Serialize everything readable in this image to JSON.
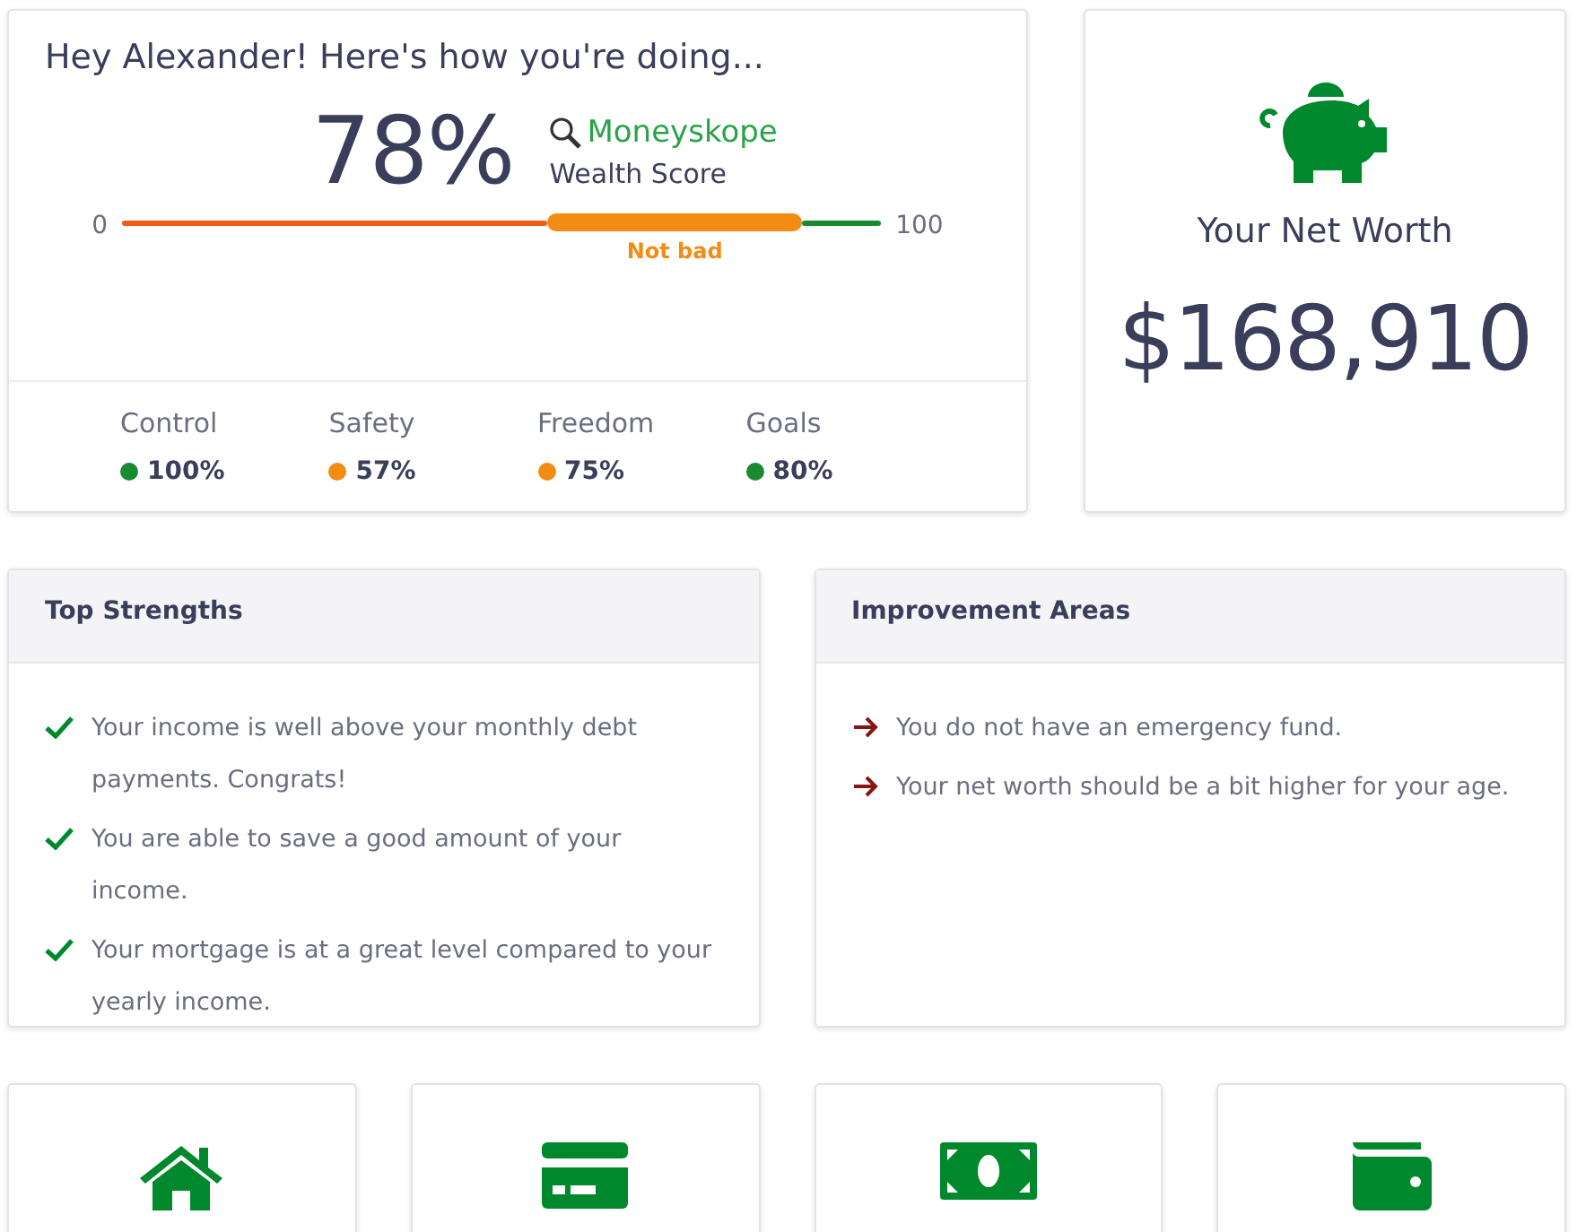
{
  "score_card": {
    "title": "Hey Alexander! Here's how you're doing...",
    "score": "78%",
    "brand": "Moneyskope",
    "subtitle": "Wealth Score",
    "min": "0",
    "max": "100",
    "rating": "Not bad",
    "segments": [
      {
        "color": "#f05a16",
        "selected": false
      },
      {
        "color": "#f28c12",
        "selected": true
      },
      {
        "color": "#1a8a2e",
        "selected": false
      }
    ],
    "metrics": [
      {
        "name": "Control",
        "value": "100%",
        "color": "#1a8a2e"
      },
      {
        "name": "Safety",
        "value": "57%",
        "color": "#f28c12"
      },
      {
        "name": "Freedom",
        "value": "75%",
        "color": "#f28c12"
      },
      {
        "name": "Goals",
        "value": "80%",
        "color": "#1a8a2e"
      }
    ]
  },
  "net_worth": {
    "label": "Your Net Worth",
    "value": "$168,910"
  },
  "panels": [
    {
      "title": "Top Strengths",
      "kind": "strength",
      "items": [
        "Your income is well above your monthly debt payments. Congrats!",
        "You are able to save a good amount of your income.",
        "Your mortgage is at a great level compared to your yearly income."
      ]
    },
    {
      "title": "Improvement Areas",
      "kind": "improvement",
      "items": [
        "You do not have an emergency fund.",
        "Your net worth should be a bit higher for your age."
      ]
    }
  ],
  "tiles": [
    {
      "kind": "house"
    },
    {
      "kind": "card"
    },
    {
      "kind": "cash"
    },
    {
      "kind": "wallet"
    }
  ]
}
